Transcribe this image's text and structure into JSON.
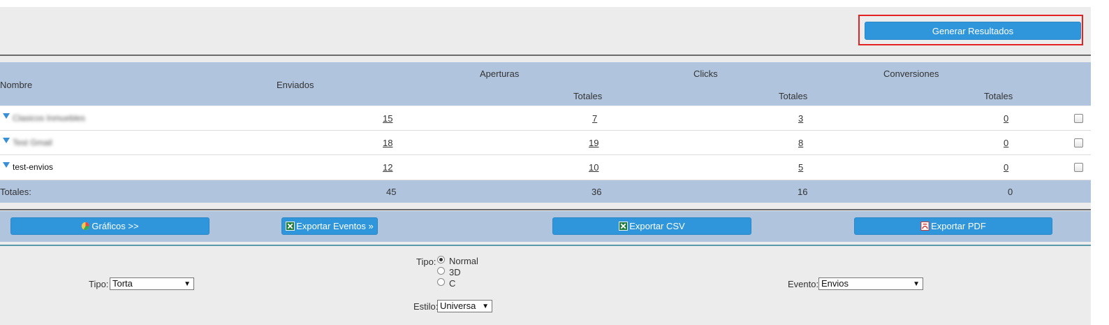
{
  "header": {
    "generate_button": "Generar Resultados"
  },
  "table": {
    "columns": {
      "nombre": "Nombre",
      "enviados": "Enviados",
      "aperturas": "Aperturas",
      "clicks": "Clicks",
      "conversiones": "Conversiones",
      "totales": "Totales"
    },
    "rows": [
      {
        "name": "Clasicos Inmuebles",
        "name_blurred": true,
        "enviados": "15",
        "aperturas": "7",
        "clicks": "3",
        "conversiones": "0"
      },
      {
        "name": "Test Gmail",
        "name_blurred": true,
        "enviados": "18",
        "aperturas": "19",
        "clicks": "8",
        "conversiones": "0"
      },
      {
        "name": "test-envios",
        "name_blurred": false,
        "enviados": "12",
        "aperturas": "10",
        "clicks": "5",
        "conversiones": "0"
      }
    ],
    "totals": {
      "label": "Totales:",
      "enviados": "45",
      "aperturas": "36",
      "clicks": "16",
      "conversiones": "0"
    }
  },
  "actions": {
    "graficos": "Gráficos >>",
    "exportar_eventos": "Exportar Eventos »",
    "exportar_csv": "Exportar CSV",
    "exportar_pdf": "Exportar PDF"
  },
  "chart_options": {
    "tipo_label": "Tipo:",
    "tipo_value": "Torta",
    "style_tipo_label": "Tipo:",
    "style_options": [
      "Normal",
      "3D",
      "C"
    ],
    "style_selected": "Normal",
    "estilo_label": "Estilo:",
    "estilo_value": "Universa",
    "evento_label": "Evento:",
    "evento_value": "Envios"
  },
  "colors": {
    "accent": "#2f96dc",
    "header_bg": "#b0c4de",
    "highlight": "#e32222"
  }
}
